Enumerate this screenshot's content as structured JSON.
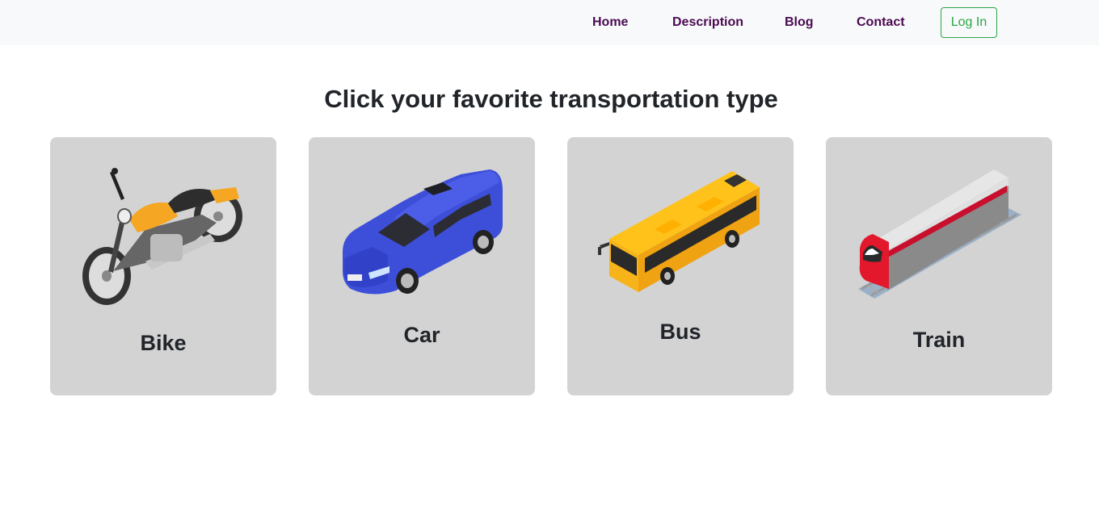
{
  "nav": {
    "home": "Home",
    "description": "Description",
    "blog": "Blog",
    "contact": "Contact",
    "login": "Log In"
  },
  "title": "Click your favorite transportation type",
  "cards": [
    {
      "label": "Bike",
      "icon": "motorcycle-icon"
    },
    {
      "label": "Car",
      "icon": "car-icon"
    },
    {
      "label": "Bus",
      "icon": "bus-icon"
    },
    {
      "label": "Train",
      "icon": "train-icon"
    }
  ],
  "colors": {
    "nav_link": "#4a0a52",
    "login_accent": "#28a745",
    "card_bg": "#d3d3d3",
    "navbar_bg": "#f8f9fa"
  }
}
